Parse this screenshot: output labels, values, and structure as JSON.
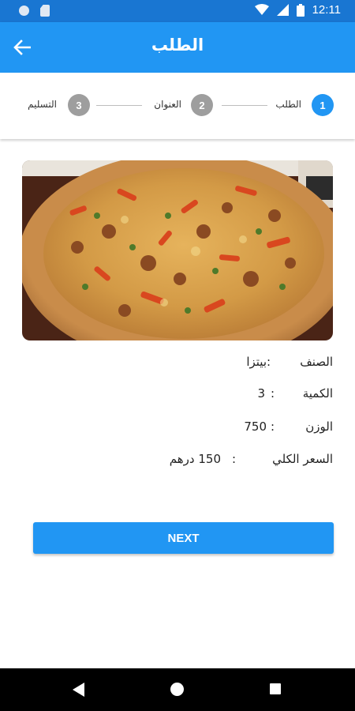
{
  "status_bar": {
    "time": "12:11",
    "icons": [
      "notification-circle-icon",
      "sim-card-icon",
      "wifi-icon",
      "cellular-signal-icon",
      "battery-icon"
    ]
  },
  "app_bar": {
    "title": "الطلب",
    "back_icon": "arrow-back-icon",
    "color": "#2196f3"
  },
  "stepper": {
    "steps": [
      {
        "number": "1",
        "label": "الطلب",
        "state": "active",
        "color": "#2196f3"
      },
      {
        "number": "2",
        "label": "العنوان",
        "state": "inactive",
        "color": "#9e9e9e"
      },
      {
        "number": "3",
        "label": "التسليم",
        "state": "inactive",
        "color": "#9e9e9e"
      }
    ]
  },
  "product_image": {
    "description": "pizza"
  },
  "order_details": {
    "colon": ":",
    "rows": [
      {
        "label": "الصنف",
        "value": "بيتزا"
      },
      {
        "label": "الكمية",
        "value": "3"
      },
      {
        "label": "الوزن",
        "value": "750"
      },
      {
        "label": "السعر الكلي",
        "value": "150 درهم"
      }
    ]
  },
  "actions": {
    "next_label": "NEXT"
  },
  "nav_bar": {
    "icons": [
      "nav-back-icon",
      "nav-home-icon",
      "nav-recents-icon"
    ]
  }
}
